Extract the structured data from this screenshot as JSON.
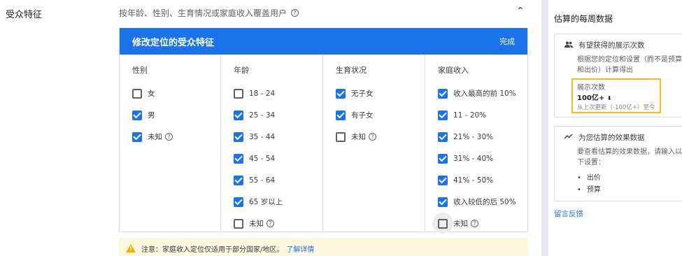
{
  "section": {
    "label": "受众特征",
    "subtitle": "按年龄、性别、生育情况或家庭收入覆盖用户",
    "help_glyph": "?",
    "collapse_glyph": "⌃"
  },
  "editor": {
    "title": "修改定位的受众特征",
    "done_label": "完成",
    "columns": [
      {
        "title": "性别",
        "options": [
          {
            "label": "女",
            "checked": false
          },
          {
            "label": "男",
            "checked": true
          },
          {
            "label": "未知",
            "checked": true,
            "help": true
          }
        ]
      },
      {
        "title": "年龄",
        "options": [
          {
            "label": "18 - 24",
            "checked": false
          },
          {
            "label": "25 - 34",
            "checked": true
          },
          {
            "label": "35 - 44",
            "checked": true
          },
          {
            "label": "45 - 54",
            "checked": true
          },
          {
            "label": "55 - 64",
            "checked": true
          },
          {
            "label": "65 岁以上",
            "checked": true
          },
          {
            "label": "未知",
            "checked": false,
            "help": true
          }
        ]
      },
      {
        "title": "生育状况",
        "options": [
          {
            "label": "无子女",
            "checked": true
          },
          {
            "label": "有子女",
            "checked": true
          },
          {
            "label": "未知",
            "checked": false,
            "help": true
          }
        ]
      },
      {
        "title": "家庭收入",
        "options": [
          {
            "label": "收入最高的前 10%",
            "checked": true
          },
          {
            "label": "11 - 20%",
            "checked": true
          },
          {
            "label": "21% - 30%",
            "checked": true
          },
          {
            "label": "31% - 40%",
            "checked": true
          },
          {
            "label": "41% - 50%",
            "checked": true
          },
          {
            "label": "收入较低的后 50%",
            "checked": true
          },
          {
            "label": "未知",
            "checked": false,
            "help": true,
            "hovered": true
          }
        ]
      }
    ]
  },
  "notice": {
    "text": "注意：家庭收入定位仅适用于部分国家/地区。",
    "link": "了解详情"
  },
  "side_panel": {
    "title": "估算的每周数据",
    "impressions_card": {
      "heading": "有望获得的展示次数",
      "description": "根据您的定位和设置（而不是预算和出价）计算得出",
      "metric_label": "展示次数",
      "metric_value": "100亿+",
      "metric_change": "从上次更新（-100亿+）至今"
    },
    "performance_card": {
      "heading": "为您估算的效果数据",
      "description": "要查看估算的效果数据，请输入以下设置：",
      "items": [
        "出价",
        "预算"
      ]
    },
    "feedback_link": "留言反馈"
  },
  "colors": {
    "accent": "#1a73e8",
    "highlight_border": "#f9bc15",
    "notice_bg": "#fef7e0",
    "warning": "#f9ab00"
  }
}
